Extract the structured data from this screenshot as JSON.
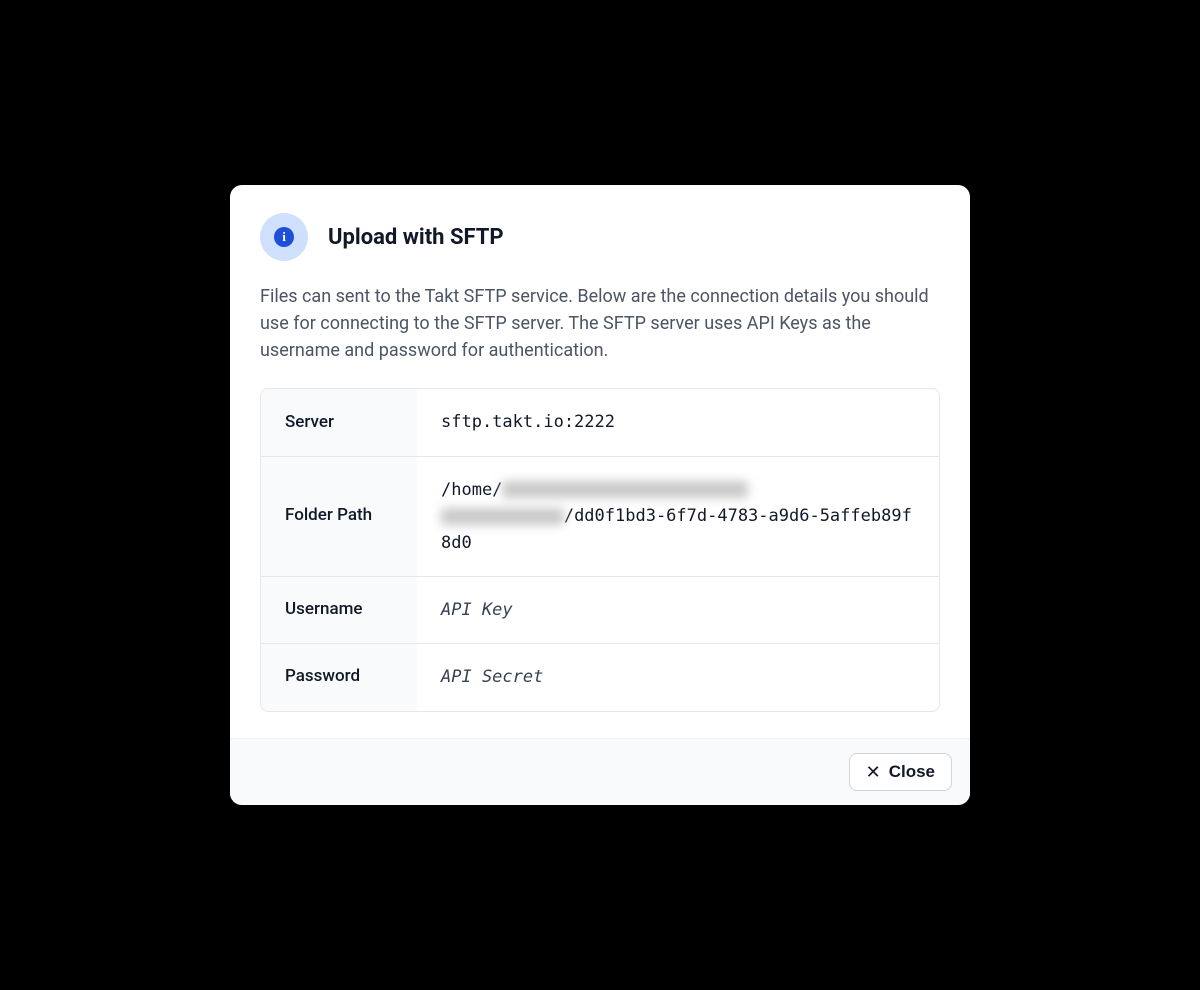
{
  "dialog": {
    "title": "Upload with SFTP",
    "description": "Files can sent to the Takt SFTP service. Below are the connection details you should use for connecting to the SFTP server. The SFTP server uses API Keys as the username and password for authentication.",
    "rows": {
      "server": {
        "label": "Server",
        "value": "sftp.takt.io:2222"
      },
      "folderPath": {
        "label": "Folder Path",
        "prefix": "/home/",
        "redacted1": "xxxxxxxx-xxxx-xxxx-xxxx-",
        "redacted2": "xxxxxxxxxxxx",
        "suffix": "/dd0f1bd3-6f7d-4783-a9d6-5affeb89f8d0"
      },
      "username": {
        "label": "Username",
        "value": "API Key"
      },
      "password": {
        "label": "Password",
        "value": "API Secret"
      }
    },
    "closeLabel": "Close"
  }
}
